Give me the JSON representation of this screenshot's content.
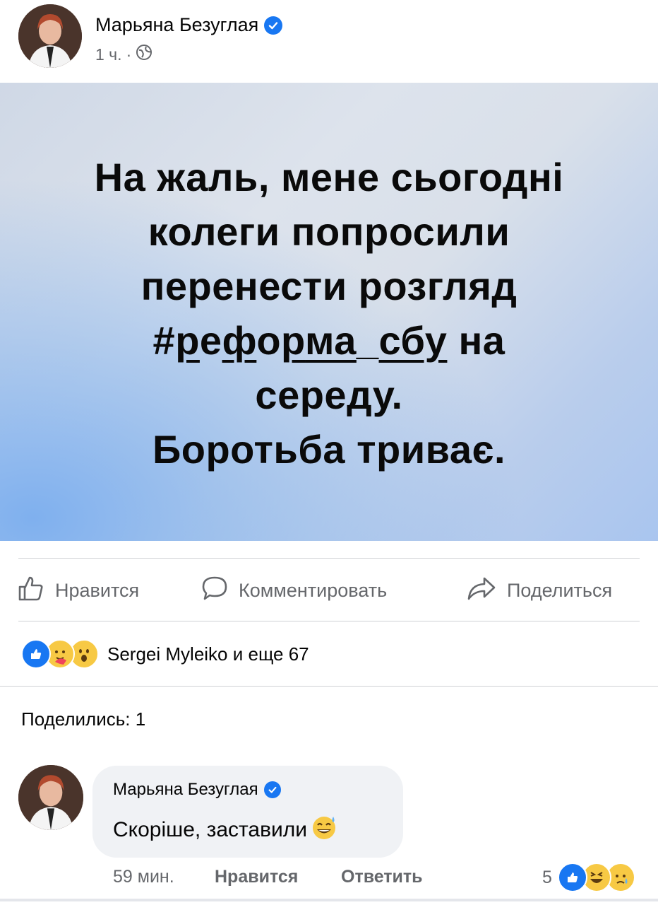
{
  "post": {
    "author": "Марьяна Безуглая",
    "time": "1 ч.",
    "separator": "·",
    "text_lines": [
      "На жаль, мене сьогодні",
      "колеги попросили",
      "перенести розгляд"
    ],
    "hashtag_parts": [
      "#",
      "р",
      "е",
      "ф",
      "о",
      "р",
      "ма",
      "_",
      "сбу"
    ],
    "after_hashtag": " на",
    "text_lines_end": [
      "середу.",
      "Боротьба триває."
    ]
  },
  "actions": {
    "like": "Нравится",
    "comment": "Комментировать",
    "share": "Поделиться"
  },
  "reactions_summary": "Sergei Myleiko и еще 67",
  "shares": "Поделились: 1",
  "comment": {
    "author": "Марьяна Безуглая",
    "text": "Скоріше, заставили",
    "time": "59 мин.",
    "like": "Нравится",
    "reply": "Ответить",
    "reaction_count": "5"
  },
  "colors": {
    "accent": "#1877f2",
    "secondary_text": "#65676b",
    "bubble": "#f0f2f5"
  }
}
